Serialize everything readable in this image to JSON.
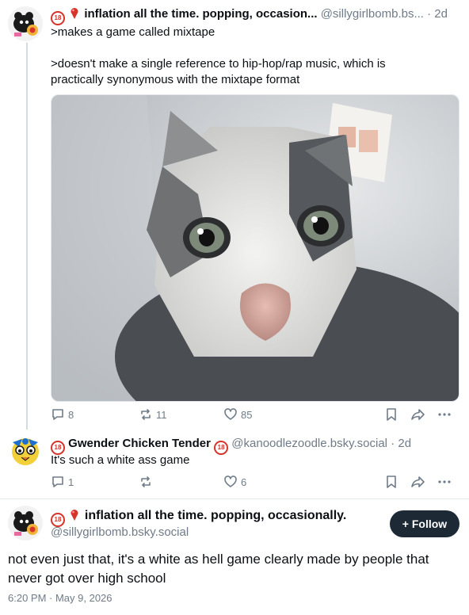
{
  "post1": {
    "display_name": "inflation all the time. popping, occasion...",
    "handle": "@sillygirlbomb.bs...",
    "age": "· 2d",
    "badge": "18",
    "lines": [
      ">makes a game called mixtape",
      ">doesn't make a single reference to hip-hop/rap music, which is",
      "practically synonymous with the mixtape format"
    ],
    "image_icon": "cat-closeup-photo",
    "actions": {
      "replies": "8",
      "reposts": "11",
      "likes": "85"
    }
  },
  "post2": {
    "display_name": "Gwender Chicken Tender",
    "handle": "@kanoodlezoodle.bsky.social",
    "age": "· 2d",
    "badge": "18",
    "text": "It's such a white ass game",
    "actions": {
      "replies": "1",
      "reposts": "",
      "likes": "6"
    }
  },
  "main_post": {
    "display_name": "inflation all the time. popping, occasionally.",
    "handle": "@sillygirlbomb.bsky.social",
    "badge": "18",
    "follow_label": "+ Follow",
    "text": "not even just that, it's a white as hell game clearly made by people that never got over high school",
    "timestamp": "6:20 PM · May 9, 2026"
  },
  "colors": {
    "accent": "#1d2a36",
    "muted": "#6f7b88",
    "badge": "#d6332b"
  }
}
